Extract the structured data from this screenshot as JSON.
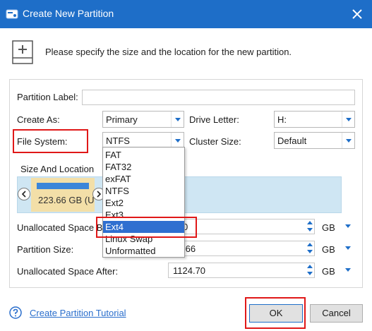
{
  "window": {
    "title": "Create New Partition"
  },
  "header": {
    "description": "Please specify the size and the location for the new partition."
  },
  "form": {
    "partition_label": {
      "label": "Partition Label:",
      "value": ""
    },
    "create_as": {
      "label": "Create As:",
      "value": "Primary"
    },
    "drive_letter": {
      "label": "Drive Letter:",
      "value": "H:"
    },
    "file_system": {
      "label": "File System:",
      "value": "NTFS"
    },
    "cluster_size": {
      "label": "Cluster Size:",
      "value": "Default"
    }
  },
  "size_location": {
    "title": "Size And Location",
    "disk_capacity": "223.66 GB (U",
    "unallocated_before": {
      "label": "Unallocated Space Be",
      "value": "0",
      "unit": "GB"
    },
    "partition_size": {
      "label": "Partition Size:",
      "value": ".66",
      "unit": "GB"
    },
    "unallocated_after": {
      "label": "Unallocated Space After:",
      "value": "1124.70",
      "unit": "GB"
    }
  },
  "file_system_dropdown": {
    "options": [
      "FAT",
      "FAT32",
      "exFAT",
      "NTFS",
      "Ext2",
      "Ext3",
      "Ext4",
      "Linux Swap",
      "Unformatted"
    ],
    "selected": "Ext4"
  },
  "footer": {
    "help_link": "Create Partition Tutorial",
    "ok_label": "OK",
    "cancel_label": "Cancel"
  },
  "colors": {
    "titlebar": "#1e6ec8",
    "accent": "#2f6fd0",
    "highlight": "#e01818",
    "size_area": "#cfe6f3",
    "disk_bar": "#f3dfa8"
  },
  "icons": {
    "title": "disk-add-icon",
    "close": "close-icon",
    "header": "new-partition-icon",
    "help": "question-icon",
    "nav_left": "chevron-left-icon",
    "nav_right": "chevron-right-icon"
  }
}
